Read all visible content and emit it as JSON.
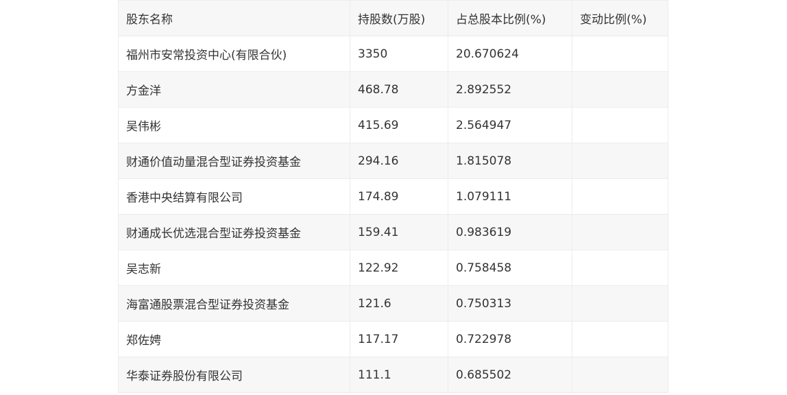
{
  "table": {
    "headers": [
      "股东名称",
      "持股数(万股)",
      "占总股本比例(%)",
      "变动比例(%)"
    ],
    "rows": [
      [
        "福州市安常投资中心(有限合伙)",
        "3350",
        "20.670624",
        ""
      ],
      [
        "方金洋",
        "468.78",
        "2.892552",
        ""
      ],
      [
        "吴伟彬",
        "415.69",
        "2.564947",
        ""
      ],
      [
        "财通价值动量混合型证券投资基金",
        "294.16",
        "1.815078",
        ""
      ],
      [
        "香港中央结算有限公司",
        "174.89",
        "1.079111",
        ""
      ],
      [
        "财通成长优选混合型证券投资基金",
        "159.41",
        "0.983619",
        ""
      ],
      [
        "吴志新",
        "122.92",
        "0.758458",
        ""
      ],
      [
        "海富通股票混合型证券投资基金",
        "121.6",
        "0.750313",
        ""
      ],
      [
        "郑佐娉",
        "117.17",
        "0.722978",
        ""
      ],
      [
        "华泰证券股份有限公司",
        "111.1",
        "0.685502",
        ""
      ]
    ]
  }
}
